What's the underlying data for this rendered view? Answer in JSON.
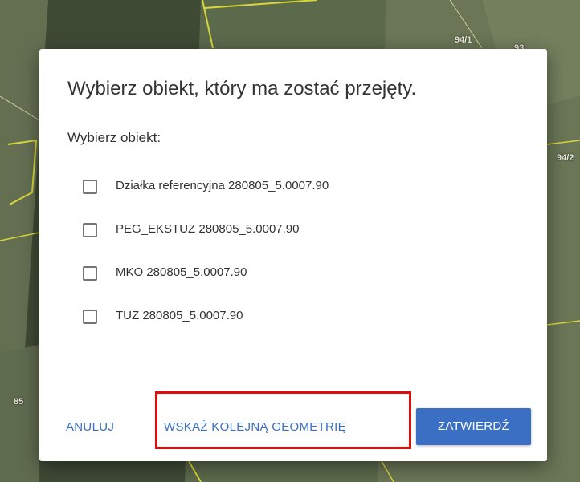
{
  "map": {
    "labels": [
      "94/1",
      "93",
      "94/2",
      "85"
    ],
    "colors": {
      "field_dark": "#3f4a35",
      "field_mid": "#5c6a4c",
      "field_light": "#7d8866",
      "parcel_border": "#d9d63a"
    }
  },
  "dialog": {
    "title": "Wybierz obiekt, który ma zostać przejęty.",
    "subtitle": "Wybierz obiekt:",
    "options": [
      {
        "label": "Działka referencyjna 280805_5.0007.90",
        "checked": false
      },
      {
        "label": "PEG_EKSTUZ 280805_5.0007.90",
        "checked": false
      },
      {
        "label": "MKO 280805_5.0007.90",
        "checked": false
      },
      {
        "label": "TUZ 280805_5.0007.90",
        "checked": false
      }
    ],
    "buttons": {
      "cancel": "ANULUJ",
      "next_geometry": "WSKAŻ KOLEJNĄ GEOMETRIĘ",
      "confirm": "ZATWIERDŹ"
    },
    "colors": {
      "accent": "#3a6fc4",
      "highlight": "#e20c0c"
    }
  }
}
